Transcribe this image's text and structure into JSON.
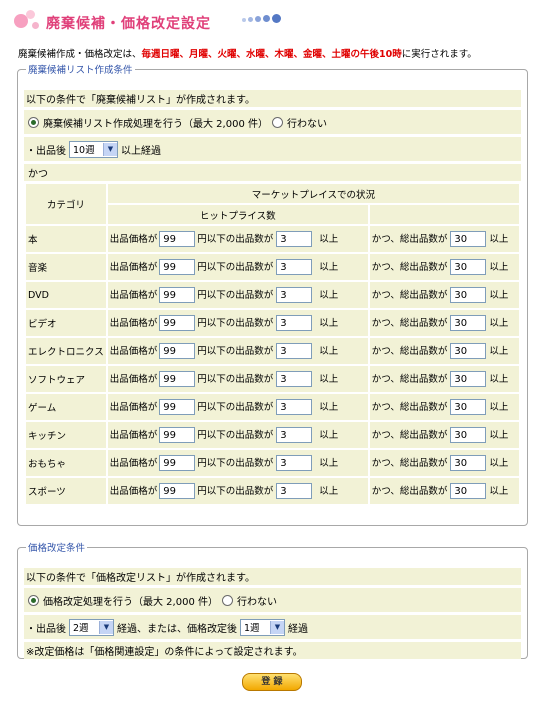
{
  "header": {
    "title": "廃棄候補・価格改定設定",
    "intro_prefix": "廃棄候補作成・価格改定は、",
    "intro_schedule": "毎週日曜、月曜、火曜、水曜、木曜、金曜、土曜の午後10時",
    "intro_suffix": "に実行されます。"
  },
  "disposal": {
    "legend": "廃棄候補リスト作成条件",
    "note": "以下の条件で「廃棄候補リスト」が作成されます。",
    "radio_do": "廃棄候補リスト作成処理を行う（最大 2,000 件）",
    "radio_dont": "行わない",
    "after_label": "・出品後",
    "after_value": "10週",
    "after_suffix": "以上経過",
    "and_label": "かつ",
    "table": {
      "col_category": "カテゴリ",
      "col_market": "マーケットプレイスでの状況",
      "col_hit": "ヒットプライス数",
      "price_label": "出品価格が",
      "below_label": "円以下の出品数が",
      "over_label": "以上",
      "and_total_label": "かつ、総出品数が",
      "rows": [
        {
          "category": "本",
          "price": "99",
          "count": "3",
          "total": "30"
        },
        {
          "category": "音楽",
          "price": "99",
          "count": "3",
          "total": "30"
        },
        {
          "category": "DVD",
          "price": "99",
          "count": "3",
          "total": "30"
        },
        {
          "category": "ビデオ",
          "price": "99",
          "count": "3",
          "total": "30"
        },
        {
          "category": "エレクトロニクス",
          "price": "99",
          "count": "3",
          "total": "30"
        },
        {
          "category": "ソフトウェア",
          "price": "99",
          "count": "3",
          "total": "30"
        },
        {
          "category": "ゲーム",
          "price": "99",
          "count": "3",
          "total": "30"
        },
        {
          "category": "キッチン",
          "price": "99",
          "count": "3",
          "total": "30"
        },
        {
          "category": "おもちゃ",
          "price": "99",
          "count": "3",
          "total": "30"
        },
        {
          "category": "スポーツ",
          "price": "99",
          "count": "3",
          "total": "30"
        }
      ]
    }
  },
  "price": {
    "legend": "価格改定条件",
    "note": "以下の条件で「価格改定リスト」が作成されます。",
    "radio_do": "価格改定処理を行う（最大 2,000 件）",
    "radio_dont": "行わない",
    "after_label": "・出品後",
    "after_value": "2週",
    "after_mid": "経過、または、価格改定後",
    "revise_value": "1週",
    "revise_suffix": "経過",
    "footnote": "※改定価格は「価格関連設定」の条件によって設定されます。"
  },
  "submit_label": "登 録",
  "colors": {
    "title": "#e0407a",
    "schedule": "#e00000",
    "row_bg": "#f2f2d6",
    "legend": "#3355aa",
    "button": "#f2a800"
  }
}
